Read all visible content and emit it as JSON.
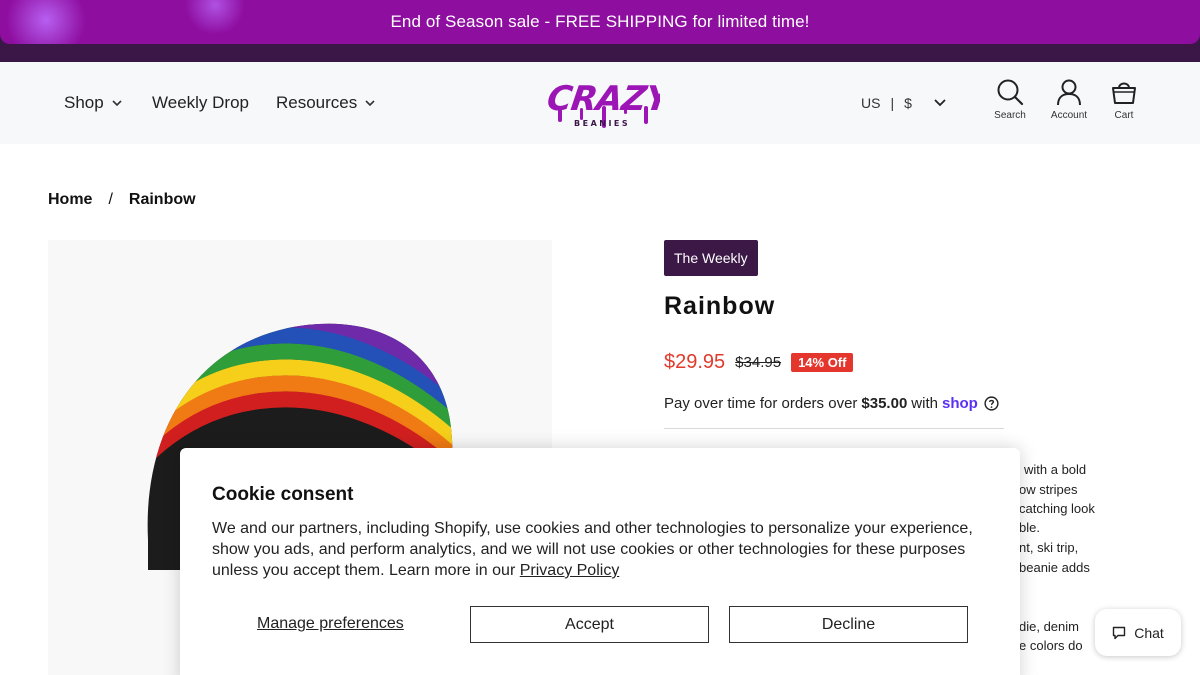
{
  "announcement": {
    "text": "End of Season sale - FREE SHIPPING for limited time!"
  },
  "header": {
    "nav": [
      {
        "label": "Shop",
        "has_dropdown": true
      },
      {
        "label": "Weekly Drop",
        "has_dropdown": false
      },
      {
        "label": "Resources",
        "has_dropdown": true
      }
    ],
    "logo": {
      "main": "CRAZY",
      "sub": "BEANIES"
    },
    "locale": {
      "country": "US",
      "separator": "|",
      "currency": "$"
    },
    "icons": [
      {
        "icon": "search-icon",
        "label": "Search"
      },
      {
        "icon": "account-icon",
        "label": "Account"
      },
      {
        "icon": "cart-icon",
        "label": "Cart"
      }
    ]
  },
  "breadcrumb": {
    "home": "Home",
    "separator": "/",
    "current": "Rainbow"
  },
  "product": {
    "badge": "The Weekly",
    "title": "Rainbow",
    "price": "$29.95",
    "compare_price": "$34.95",
    "discount": "14% Off",
    "installments": {
      "prefix": "Pay over time for orders over",
      "amount": "$35.00",
      "with": "with",
      "provider": "shop"
    },
    "description_fragments": [
      "with a bold",
      "ow stripes",
      "catching look",
      "ble.",
      "nt, ski trip,",
      "beanie adds",
      "die, denim",
      "e colors do"
    ]
  },
  "cookie": {
    "title": "Cookie consent",
    "body": "We and our partners, including Shopify, use cookies and other technologies to personalize your experience, show you ads, and perform analytics, and we will not use cookies or other technologies for these purposes unless you accept them. Learn more in our",
    "policy_link": "Privacy Policy",
    "manage_label": "Manage preferences",
    "accept_label": "Accept",
    "decline_label": "Decline"
  },
  "chat": {
    "label": "Chat"
  },
  "colors": {
    "brand_purple": "#8e0ea0",
    "dark_purple": "#3a1747",
    "sale_red": "#e03b2c",
    "shop_pay": "#5a31f4"
  }
}
